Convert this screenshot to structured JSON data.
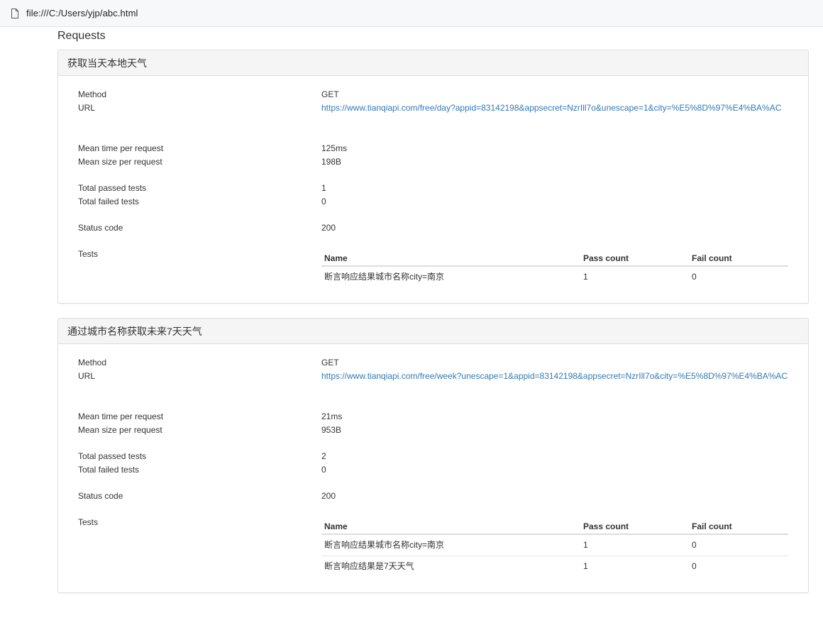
{
  "browser": {
    "url": "file:///C:/Users/yjp/abc.html"
  },
  "section_title": "Requests",
  "labels": {
    "method": "Method",
    "url": "URL",
    "mean_time": "Mean time per request",
    "mean_size": "Mean size per request",
    "total_passed": "Total passed tests",
    "total_failed": "Total failed tests",
    "status_code": "Status code",
    "tests": "Tests",
    "col_name": "Name",
    "col_pass": "Pass count",
    "col_fail": "Fail count"
  },
  "requests": [
    {
      "title": "获取当天本地天气",
      "method": "GET",
      "url": "https://www.tianqiapi.com/free/day?appid=83142198&appsecret=NzrIll7o&unescape=1&city=%E5%8D%97%E4%BA%AC",
      "mean_time": "125ms",
      "mean_size": "198B",
      "total_passed": "1",
      "total_failed": "0",
      "status_code": "200",
      "tests": [
        {
          "name": "断言响应结果城市名称city=南京",
          "pass": "1",
          "fail": "0"
        }
      ]
    },
    {
      "title": "通过城市名称获取未来7天天气",
      "method": "GET",
      "url": "https://www.tianqiapi.com/free/week?unescape=1&appid=83142198&appsecret=NzrIll7o&city=%E5%8D%97%E4%BA%AC",
      "mean_time": "21ms",
      "mean_size": "953B",
      "total_passed": "2",
      "total_failed": "0",
      "status_code": "200",
      "tests": [
        {
          "name": "断言响应结果城市名称city=南京",
          "pass": "1",
          "fail": "0"
        },
        {
          "name": "断言响应结果是7天天气",
          "pass": "1",
          "fail": "0"
        }
      ]
    }
  ]
}
